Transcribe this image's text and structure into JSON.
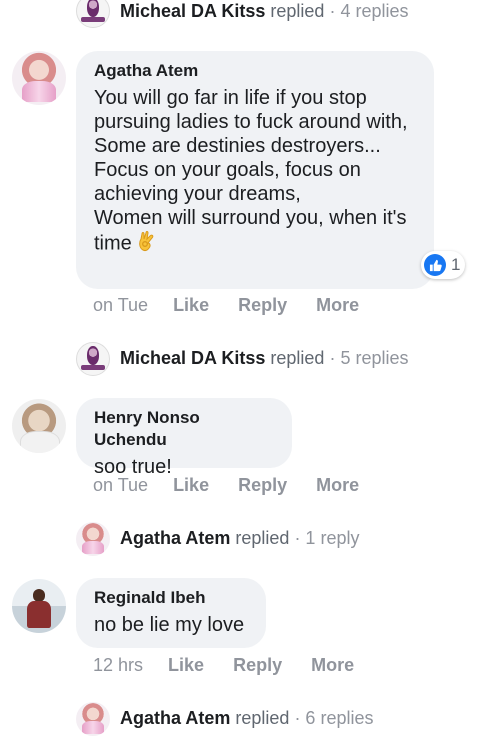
{
  "thread": {
    "reply_summaries": [
      {
        "name": "Micheal DA Kitss",
        "verb": "replied",
        "count": "· 4 replies"
      },
      {
        "name": "Micheal DA Kitss",
        "verb": "replied",
        "count": "· 5 replies"
      },
      {
        "name": "Agatha Atem",
        "verb": "replied",
        "count": "· 1 reply"
      },
      {
        "name": "Agatha Atem",
        "verb": "replied",
        "count": "· 6 replies"
      }
    ],
    "comments": [
      {
        "author": "Agatha Atem",
        "text": "You will go far in life if you stop pursuing ladies to fuck around with,\nSome are destinies destroyers...\nFocus on your goals, focus on achieving your dreams,\nWomen will surround you, when it's time",
        "emoji_icon": "ok-hand-emoji",
        "reaction_icon": "like-icon",
        "reaction_count": "1",
        "time": "on Tue",
        "actions": [
          "Like",
          "Reply",
          "More"
        ]
      },
      {
        "author": "Henry Nonso Uchendu",
        "text": "soo true!",
        "time": "on Tue",
        "actions": [
          "Like",
          "Reply",
          "More"
        ]
      },
      {
        "author": "Reginald Ibeh",
        "text": "no be lie my love",
        "time": "12 hrs",
        "actions": [
          "Like",
          "Reply",
          "More"
        ]
      }
    ]
  },
  "colors": {
    "bubble_bg": "#f0f2f5",
    "like_blue": "#1877f2",
    "meta_gray": "#90949c"
  }
}
